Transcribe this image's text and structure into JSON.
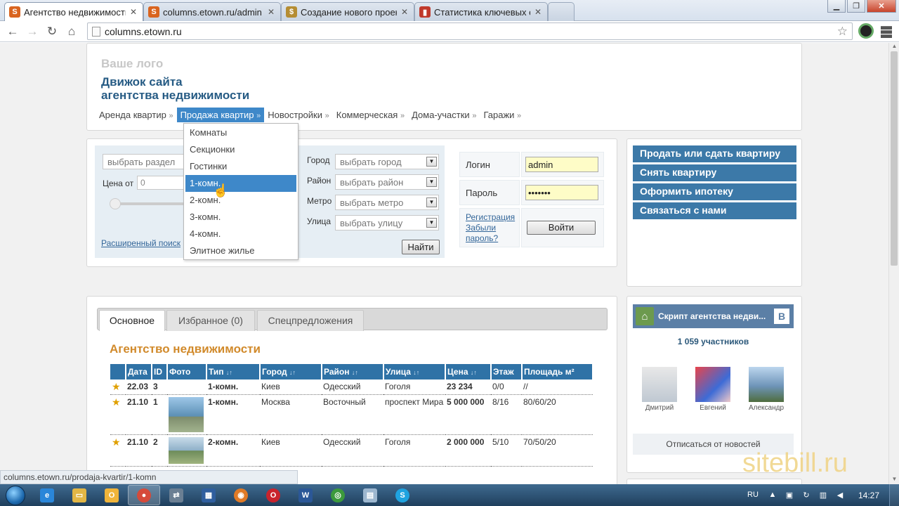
{
  "browser": {
    "tabs": [
      {
        "label": "Агентство недвижимости",
        "favicon": "S",
        "color": "#d9641f"
      },
      {
        "label": "columns.etown.ru/admin",
        "favicon": "S",
        "color": "#d9641f"
      },
      {
        "label": "Создание нового проект",
        "favicon": "$",
        "color": "#b58d33"
      },
      {
        "label": "Статистика ключевых сл",
        "favicon": "▮",
        "color": "#c0392b"
      }
    ],
    "url": "columns.etown.ru",
    "status_url": "columns.etown.ru/prodaja-kvartir/1-komn"
  },
  "header": {
    "logo_small": "Ваше лого",
    "logo_line1": "Движок сайта",
    "logo_line2": "агентства недвижимости"
  },
  "nav": {
    "items": [
      {
        "label": "Аренда квартир"
      },
      {
        "label": "Продажа квартир"
      },
      {
        "label": "Новостройки"
      },
      {
        "label": "Коммерческая"
      },
      {
        "label": "Дома-участки"
      },
      {
        "label": "Гаражи"
      }
    ],
    "raquo": "»",
    "dropdown": [
      "Комнаты",
      "Секционки",
      "Гостинки",
      "1-комн.",
      "2-комн.",
      "3-комн.",
      "4-комн.",
      "Элитное жилье"
    ]
  },
  "search": {
    "section_placeholder": "выбрать раздел",
    "price_label": "Цена от",
    "price_value": "0",
    "city_label": "Город",
    "city_value": "выбрать город",
    "district_label": "Район",
    "district_value": "выбрать район",
    "metro_label": "Метро",
    "metro_value": "выбрать метро",
    "street_label": "Улица",
    "street_value": "выбрать улицу",
    "advanced_link": "Расширенный поиск",
    "find_button": "Найти"
  },
  "login": {
    "login_label": "Логин",
    "login_value": "admin",
    "password_label": "Пароль",
    "password_value": "•••••••",
    "register_link": "Регистрация",
    "forgot_link_1": "Забыли",
    "forgot_link_2": "пароль?",
    "login_button": "Войти"
  },
  "right_menu": [
    "Продать или сдать квартиру",
    "Снять квартиру",
    "Оформить ипотеку",
    "Связаться с нами"
  ],
  "tabs": {
    "main": "Основное",
    "favorites": "Избранное (0)",
    "special": "Спецпредложения"
  },
  "listing": {
    "title": "Агентство недвижимости",
    "columns": [
      "Дата",
      "ID",
      "Фото",
      "Тип",
      "Город",
      "Район",
      "Улица",
      "Цена",
      "Этаж",
      "Площадь м²"
    ],
    "sort_mark": "↓↑",
    "rows": [
      {
        "date": "22.03",
        "id": "3",
        "type": "1-комн.",
        "city": "Киев",
        "district": "Одесский",
        "street": "Гоголя",
        "price": "23 234",
        "floor": "0/0",
        "area": "//"
      },
      {
        "date": "21.10",
        "id": "1",
        "type": "1-комн.",
        "city": "Москва",
        "district": "Восточный",
        "street": "проспект Мира",
        "price": "5 000 000",
        "floor": "8/16",
        "area": "80/60/20"
      },
      {
        "date": "21.10",
        "id": "2",
        "type": "2-комн.",
        "city": "Киев",
        "district": "Одесский",
        "street": "Гоголя",
        "price": "2 000 000",
        "floor": "5/10",
        "area": "70/50/20"
      }
    ]
  },
  "vk": {
    "title": "Скрипт агентства недви...",
    "logo": "B",
    "members": "1 059 участников",
    "people": [
      "Дмитрий",
      "Евгений",
      "Александр"
    ],
    "unsubscribe": "Отписаться от новостей"
  },
  "watermark": "sitebill.ru",
  "taskbar": {
    "lang": "RU",
    "time": "14:27"
  }
}
